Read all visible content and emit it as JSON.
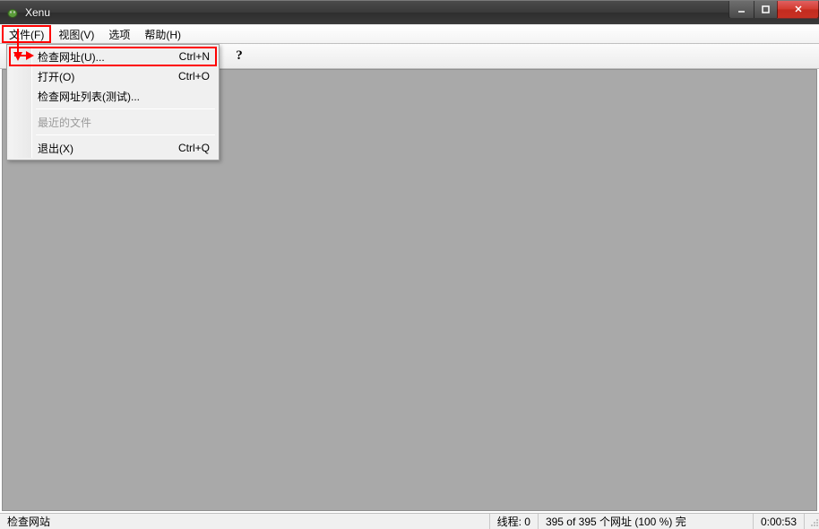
{
  "window": {
    "title": "Xenu"
  },
  "menu": {
    "file": "文件(F)",
    "view": "视图(V)",
    "options": "选项",
    "help": "帮助(H)"
  },
  "file_menu": {
    "check_url": "检查网址(U)...",
    "check_url_sc": "Ctrl+N",
    "open": "打开(O)",
    "open_sc": "Ctrl+O",
    "check_list": "检查网址列表(测试)...",
    "recent_disabled": "最近的文件",
    "exit": "退出(X)",
    "exit_sc": "Ctrl+Q"
  },
  "toolbar": {
    "help_glyph": "?"
  },
  "status": {
    "left": "检查网站",
    "threads": "线程: 0",
    "progress": "395 of 395 个网址 (100 %)  完",
    "elapsed": "0:00:53"
  }
}
